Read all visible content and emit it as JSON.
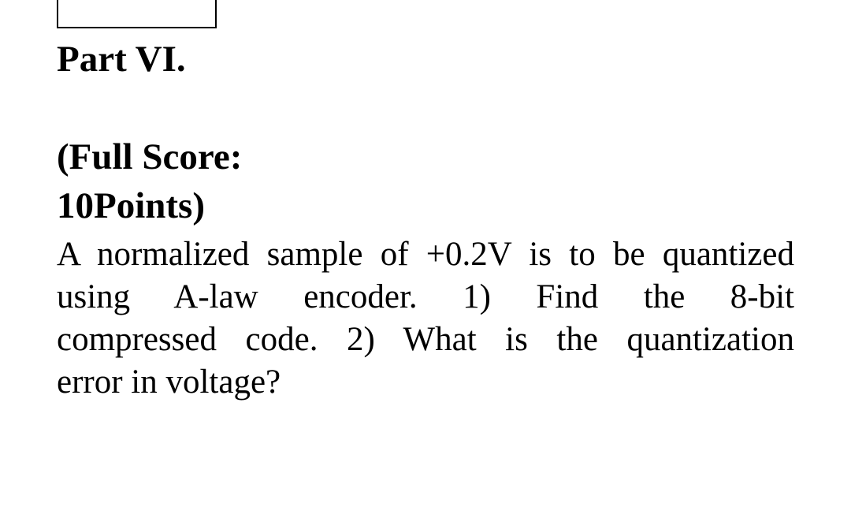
{
  "slide": {
    "background_color": "#ffffff",
    "text_color": "#000000"
  },
  "placeholder_box": {
    "label": "",
    "border_color": "#000000"
  },
  "heading": {
    "part_label": "Part VI.",
    "score_open": "(Full Score:",
    "score_close": "10Points)",
    "full_text": "Part VI.                    (Full Score: 10Points)"
  },
  "body": {
    "full_text": "A normalized sample of +0.2V is to be quantized using A-law encoder. 1) Find the 8-bit compressed code. 2) What is the quantization error in voltage?",
    "lines": [
      "A normalized sample of +0.2V is to be quantized",
      "using A-law encoder. 1) Find the 8-bit",
      "compressed code. 2) What is the quantization",
      "error in voltage?"
    ]
  }
}
